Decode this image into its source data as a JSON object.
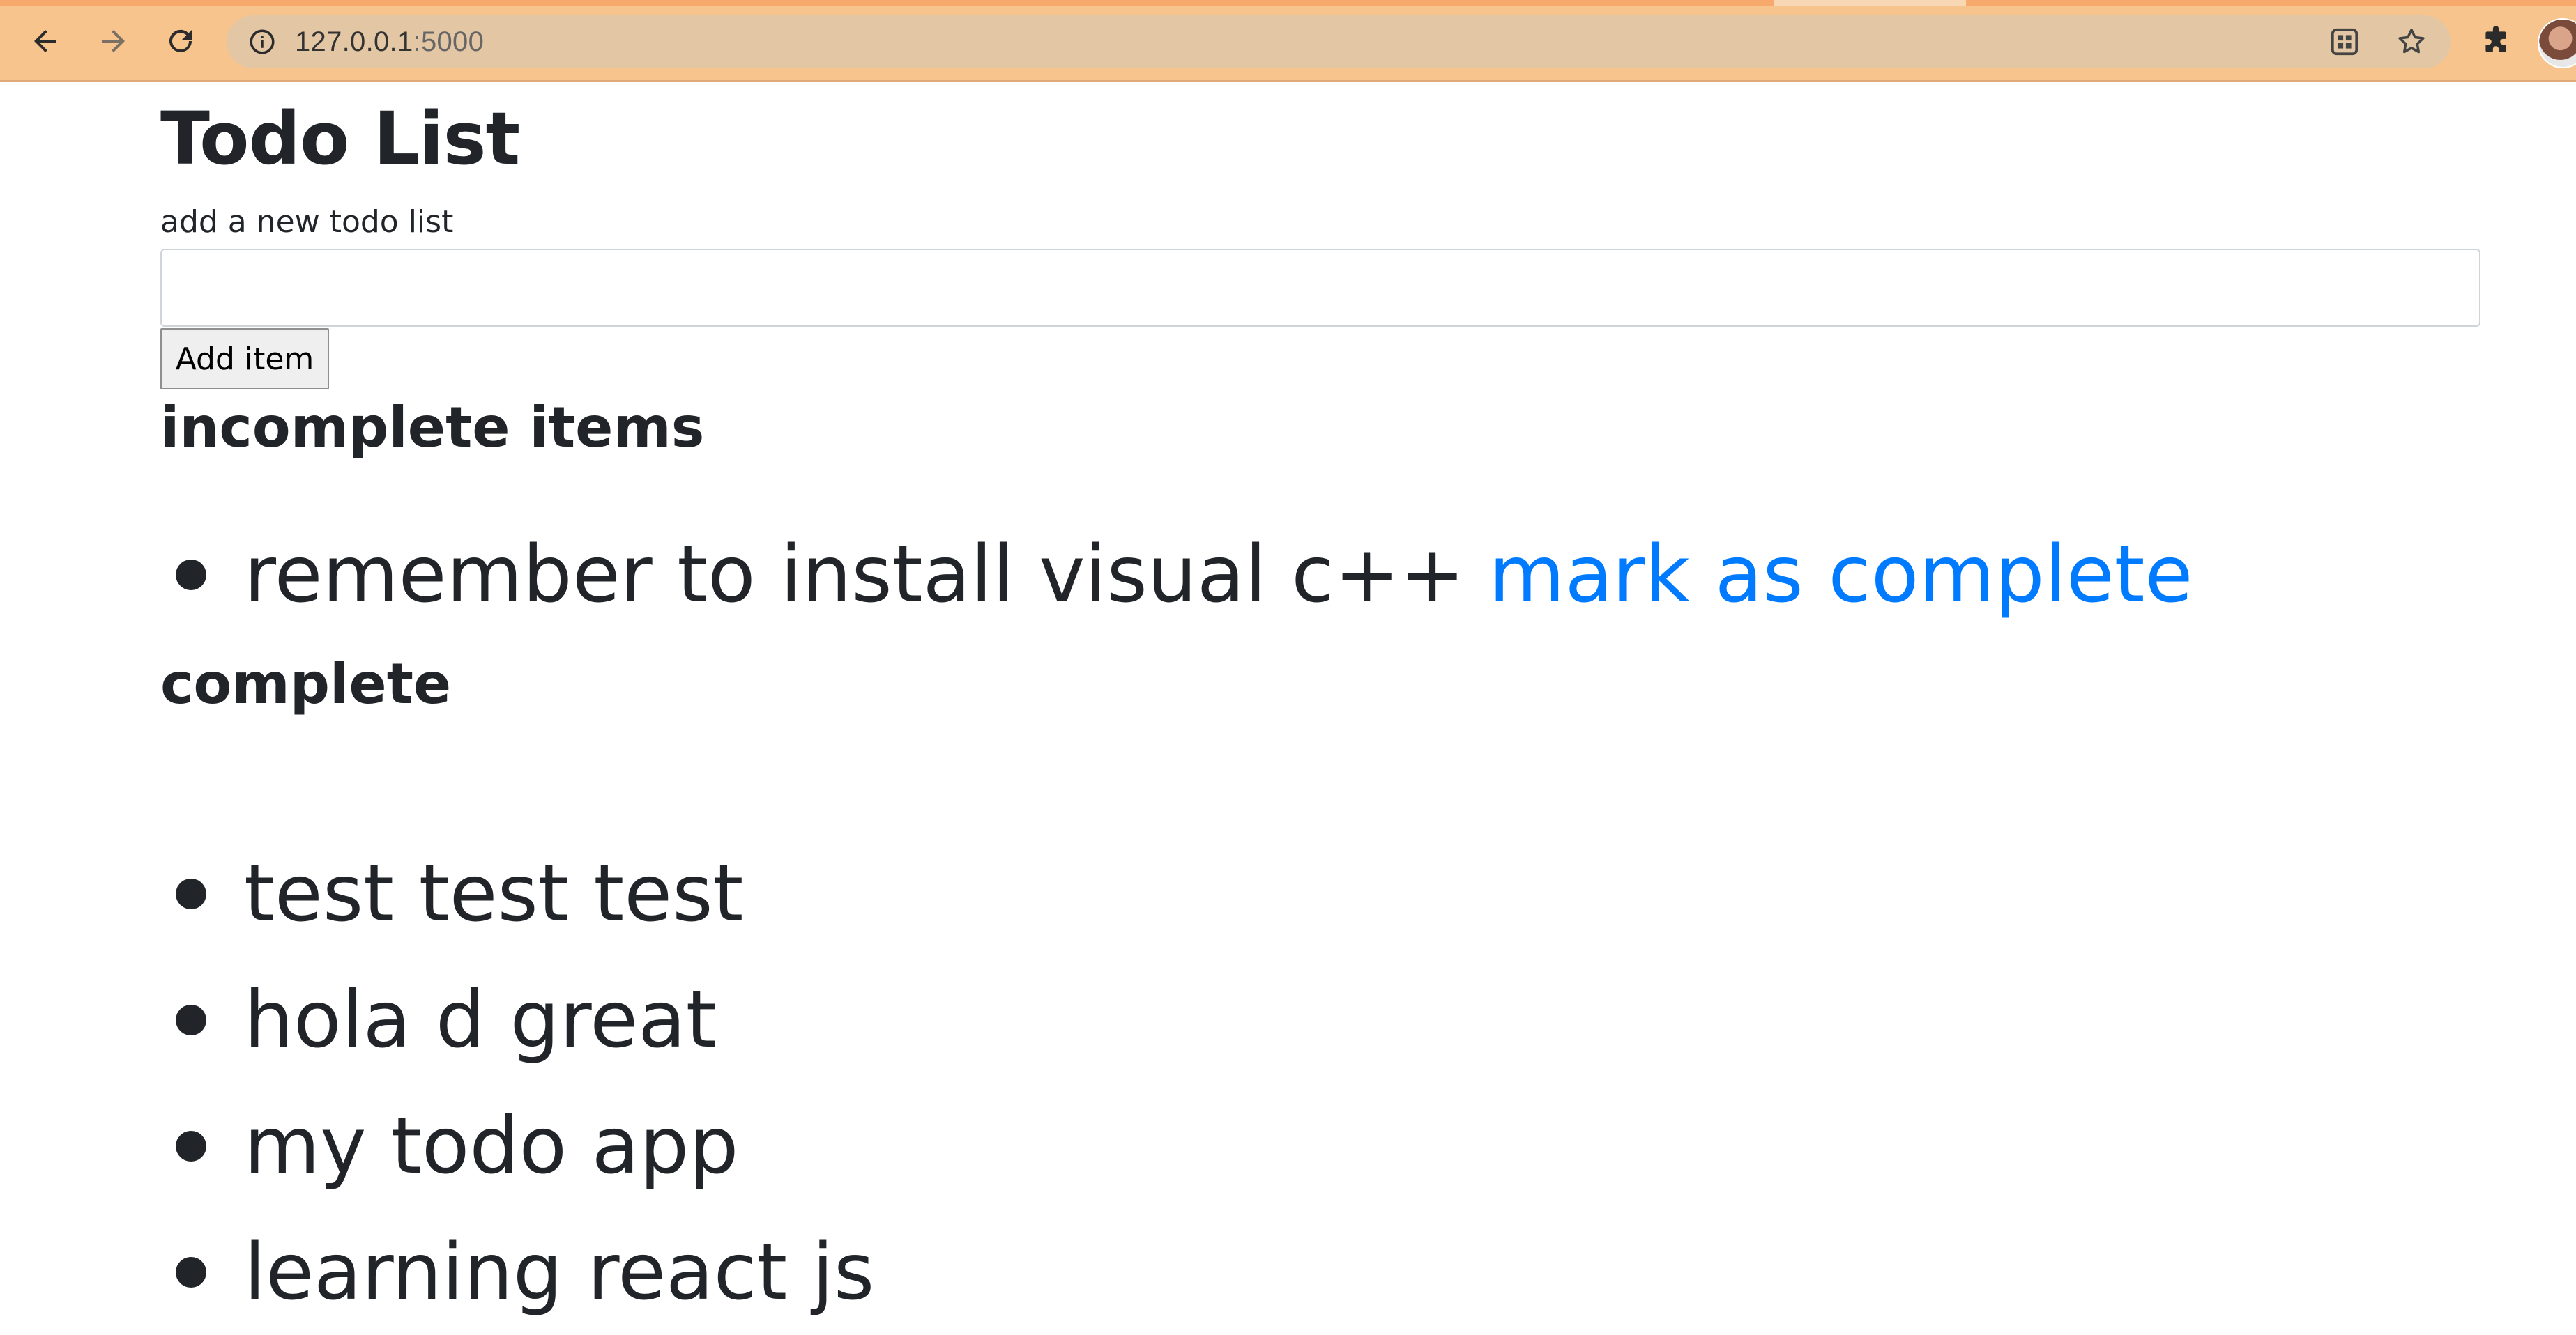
{
  "browser": {
    "url_host": "127.0.0.1",
    "url_port": ":5000",
    "icons": [
      "back-arrow-icon",
      "forward-arrow-icon",
      "reload-icon",
      "info-icon",
      "qr-code-icon",
      "star-icon",
      "puzzle-extension-icon"
    ],
    "accent_color": "#f8c48e"
  },
  "page": {
    "title": "Todo List",
    "input_label": "add a new todo list",
    "input_value": "",
    "add_button_label": "Add item",
    "incomplete_heading": "incomplete items",
    "complete_heading": "complete",
    "link_color": "#007bff"
  },
  "incomplete_items": [
    {
      "text": "remember to install visual c++",
      "action": "mark as complete"
    }
  ],
  "complete_items": [
    {
      "text": "test test test"
    },
    {
      "text": "hola d great"
    },
    {
      "text": "my todo app"
    },
    {
      "text": "learning react js"
    }
  ]
}
